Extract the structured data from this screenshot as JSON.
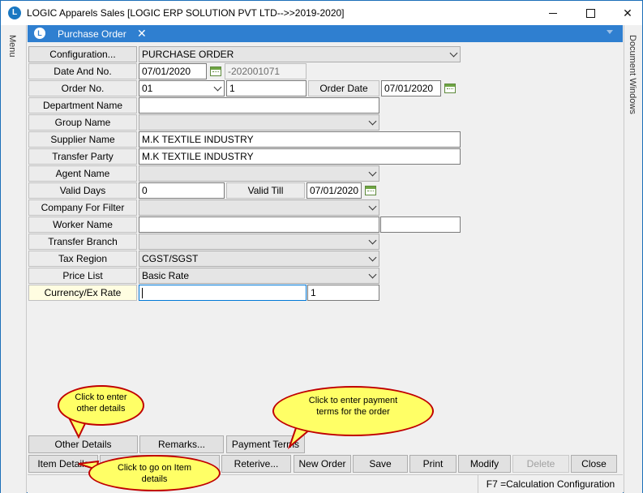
{
  "window": {
    "title": "LOGIC Apparels Sales  [LOGIC ERP SOLUTION PVT LTD-->>2019-2020]",
    "app_icon": "logic-logo-icon",
    "controls": {
      "minimize": "minimize-icon",
      "maximize": "maximize-icon",
      "close": "✕"
    }
  },
  "side_panes": {
    "left": "Menu",
    "right": "Document Windows"
  },
  "tab": {
    "label": "Purchase Order",
    "close": "✕",
    "icon_letter": "L"
  },
  "form": {
    "configuration": {
      "label": "Configuration...",
      "value": "PURCHASE ORDER"
    },
    "date_and_no": {
      "label": "Date And No.",
      "date": "07/01/2020",
      "number": "-202001071"
    },
    "order_no": {
      "label": "Order No.",
      "series": "01",
      "number": "1",
      "order_date_label": "Order Date",
      "order_date": "07/01/2020"
    },
    "department_name": {
      "label": "Department Name",
      "value": ""
    },
    "group_name": {
      "label": "Group Name",
      "value": ""
    },
    "supplier_name": {
      "label": "Supplier Name",
      "value": "M.K TEXTILE INDUSTRY"
    },
    "transfer_party": {
      "label": "Transfer Party",
      "value": "M.K TEXTILE INDUSTRY"
    },
    "agent_name": {
      "label": "Agent Name",
      "value": ""
    },
    "valid_days": {
      "label": "Valid Days",
      "value": "0",
      "valid_till_label": "Valid Till",
      "valid_till": "07/01/2020"
    },
    "company_for_filter": {
      "label": "Company For Filter",
      "value": ""
    },
    "worker_name": {
      "label": "Worker Name",
      "value": "",
      "extra": ""
    },
    "transfer_branch": {
      "label": "Transfer Branch",
      "value": ""
    },
    "tax_region": {
      "label": "Tax Region",
      "value": "CGST/SGST"
    },
    "price_list": {
      "label": "Price List",
      "value": "Basic Rate"
    },
    "currency": {
      "label": "Currency/Ex Rate",
      "value": "",
      "rate": "1"
    }
  },
  "buttons_row1": {
    "other_details": "Other Details",
    "remarks": "Remarks...",
    "payment_terms": "Payment Terms"
  },
  "buttons_row2": {
    "item_details": "Item Details",
    "retrieve": "Reterive...",
    "new_order": "New Order",
    "save": "Save",
    "print": "Print",
    "modify": "Modify",
    "delete": "Delete",
    "close": "Close"
  },
  "status": {
    "hint": "F7 =Calculation Configuration"
  },
  "callouts": {
    "other_details": "Click to enter other details",
    "payment_terms": "Click to enter payment terms for the order",
    "item_details": "Click to go on Item details"
  },
  "colors": {
    "tab_blue": "#2f7fd0",
    "callout_fill": "#ffff66",
    "callout_border": "#c00000"
  }
}
